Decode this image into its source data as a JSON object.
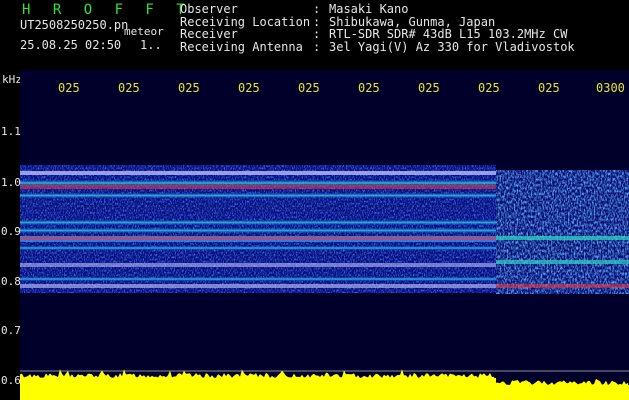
{
  "header": {
    "brand": "H R O F F T",
    "filename": "UT2508250250.pn",
    "meteor_label": "meteor",
    "datetime": "25.08.25 02:50",
    "count": "1..",
    "observer_label": "Observer",
    "observer_value": "Masaki Kano",
    "location_label": "Receiving Location",
    "location_value": "Shibukawa, Gunma, Japan",
    "receiver_label": "Receiver",
    "receiver_value": "RTL-SDR SDR# 43dB L15 103.2MHz CW",
    "antenna_label": "Receiving Antenna",
    "antenna_value": "3el Yagi(V) Az 330 for Vladivostok",
    "separator": ":"
  },
  "axis": {
    "unit": "kHz",
    "y_ticks": [
      "1.1",
      "1.0",
      "0.9",
      "0.8",
      "0.7",
      "0.6"
    ],
    "time_ticks": [
      "025",
      "025",
      "025",
      "025",
      "025",
      "025",
      "025",
      "025",
      "025",
      "0300"
    ]
  },
  "colors": {
    "background": "#00002a",
    "signal_low": "#1e3cff",
    "signal_mid": "#28e0a0",
    "signal_high": "#ff3030",
    "trace": "#ffff00",
    "grid": "#c8c8c8"
  }
}
